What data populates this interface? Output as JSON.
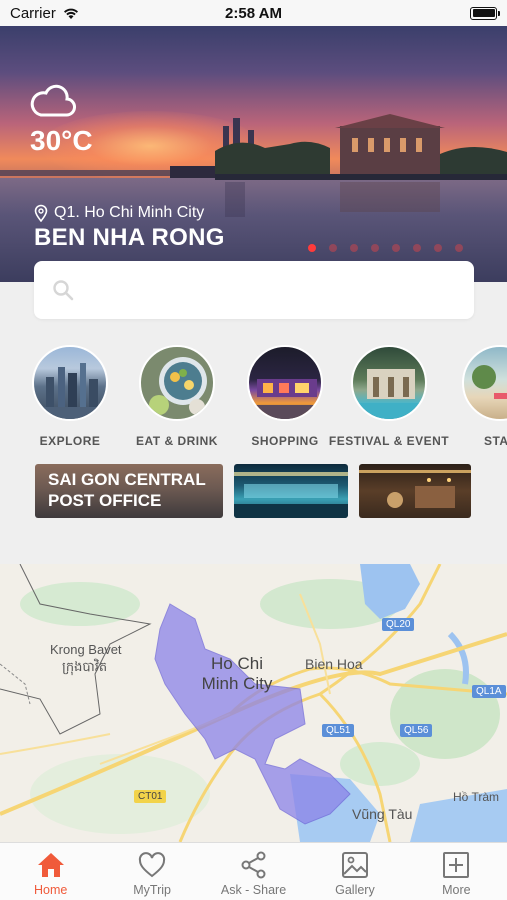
{
  "status_bar": {
    "carrier": "Carrier",
    "time": "2:58 AM",
    "battery_level": 1.0
  },
  "hero": {
    "temperature": "30°C",
    "weather_icon": "cloud-icon",
    "location": "Q1. Ho Chi Minh City",
    "title": "BEN NHA RONG",
    "carousel_count": 8,
    "carousel_active": 0
  },
  "search": {
    "placeholder": "",
    "value": ""
  },
  "categories": [
    {
      "label": "EXPLORE",
      "name": "explore"
    },
    {
      "label": "EAT & DRINK",
      "name": "eat-drink"
    },
    {
      "label": "SHOPPING",
      "name": "shopping"
    },
    {
      "label": "FESTIVAL & EVENT",
      "name": "festival-event"
    },
    {
      "label": "STAY",
      "name": "stay"
    }
  ],
  "cards": [
    {
      "title": "SAI GON CENTRAL POST OFFICE"
    },
    {
      "title": ""
    },
    {
      "title": ""
    }
  ],
  "map": {
    "labels": {
      "krong_bavet": "Krong Bavet",
      "krong_bavet_khmer": "ក្រុងបាវិត",
      "city": "Ho Chi Minh City",
      "bien_hoa": "Bien Hoa",
      "vung_tau": "Vũng Tàu",
      "ho_tram": "Hồ Tràm"
    },
    "roads": [
      "QL20",
      "QL1A",
      "QL51",
      "QL56",
      "CT01"
    ]
  },
  "tabs": [
    {
      "label": "Home",
      "icon": "home-icon",
      "active": true
    },
    {
      "label": "MyTrip",
      "icon": "heart-icon",
      "active": false
    },
    {
      "label": "Ask - Share",
      "icon": "share-icon",
      "active": false
    },
    {
      "label": "Gallery",
      "icon": "image-icon",
      "active": false
    },
    {
      "label": "More",
      "icon": "plus-square-icon",
      "active": false
    }
  ],
  "colors": {
    "accent": "#f05a3a",
    "carousel_active": "#ff3b3b",
    "map_region": "#8c83e8"
  }
}
